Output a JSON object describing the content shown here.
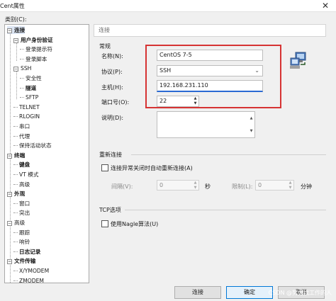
{
  "window": {
    "title": "Cent属性",
    "close_glyph": "✕"
  },
  "category_label": "类别(C):",
  "tree": [
    {
      "label": "连接",
      "bold": true,
      "expander": "−"
    },
    {
      "label": "用户身份验证",
      "bold": true,
      "expander": "−"
    },
    {
      "label": "登录提示符",
      "bold": false
    },
    {
      "label": "登录脚本",
      "bold": false
    },
    {
      "label": "SSH",
      "bold": false,
      "expander": "−"
    },
    {
      "label": "安全性",
      "bold": false
    },
    {
      "label": "隧道",
      "bold": true
    },
    {
      "label": "SFTP",
      "bold": false
    },
    {
      "label": "TELNET",
      "bold": false
    },
    {
      "label": "RLOGIN",
      "bold": false
    },
    {
      "label": "串口",
      "bold": false
    },
    {
      "label": "代理",
      "bold": false
    },
    {
      "label": "保持活动状态",
      "bold": false
    },
    {
      "label": "终端",
      "bold": true,
      "expander": "−"
    },
    {
      "label": "键盘",
      "bold": true
    },
    {
      "label": "VT 模式",
      "bold": false
    },
    {
      "label": "高级",
      "bold": false
    },
    {
      "label": "外观",
      "bold": true,
      "expander": "−"
    },
    {
      "label": "窗口",
      "bold": false
    },
    {
      "label": "突出",
      "bold": false
    },
    {
      "label": "高级",
      "bold": false,
      "expander": "−"
    },
    {
      "label": "跟踪",
      "bold": false
    },
    {
      "label": "响铃",
      "bold": false
    },
    {
      "label": "日志记录",
      "bold": true
    },
    {
      "label": "文件传输",
      "bold": true,
      "expander": "−"
    },
    {
      "label": "X/YMODEM",
      "bold": false
    },
    {
      "label": "ZMODEM",
      "bold": false
    }
  ],
  "header": {
    "title": "连接"
  },
  "general": {
    "section_label": "常规",
    "name_label": "名称(N):",
    "name_value": "CentOS 7-5",
    "protocol_label": "协议(P):",
    "protocol_value": "SSH",
    "protocol_arrow": "⌄",
    "host_label": "主机(H):",
    "host_value": "192.168.231.110",
    "port_label": "端口号(O):",
    "port_value": "22",
    "desc_label": "说明(D):",
    "desc_value": ""
  },
  "reconnect": {
    "section_label": "重新连接",
    "checkbox_label": "连接异常关闭时自动重新连接(A)",
    "checked": false,
    "interval_label": "间隔(V):",
    "interval_value": "0",
    "interval_unit": "秒",
    "limit_label": "限制(L):",
    "limit_value": "0",
    "limit_unit": "分钟"
  },
  "tcp": {
    "section_label": "TCP选项",
    "nagle_label": "使用Nagle算法(U)",
    "checked": false
  },
  "buttons": {
    "connect": "连接",
    "ok": "确定",
    "cancel": "取消"
  },
  "watermark": "CSDN @努力找工作的人"
}
